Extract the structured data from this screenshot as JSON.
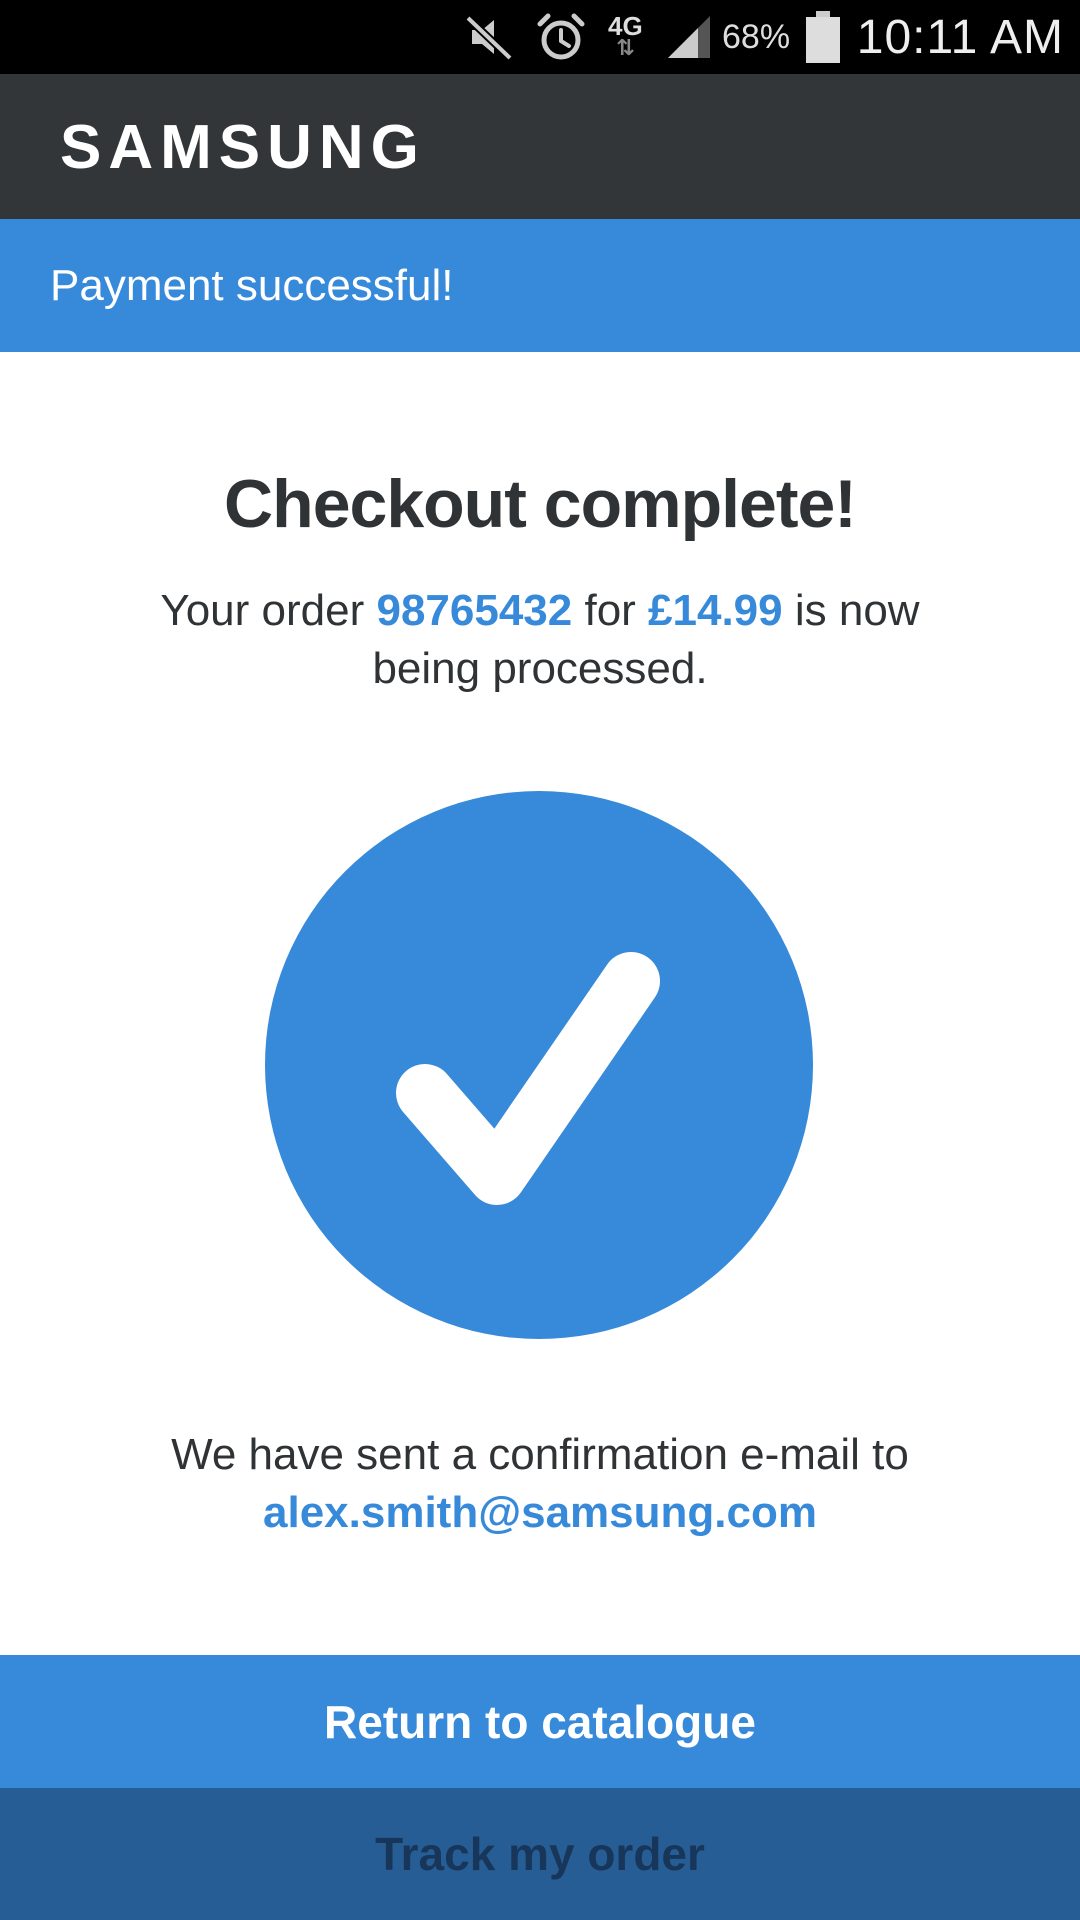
{
  "status_bar": {
    "network": "4G",
    "network_arrows": "⇅",
    "battery_percent": "68%",
    "time": "10:11 AM",
    "icons": [
      "mute-icon",
      "alarm-icon",
      "network-4g-icon",
      "signal-icon",
      "battery-icon"
    ]
  },
  "header": {
    "brand": "SAMSUNG"
  },
  "banner": {
    "message": "Payment successful!"
  },
  "main": {
    "title": "Checkout complete!",
    "order_prefix": "Your order ",
    "order_number": "98765432",
    "order_middle": " for ",
    "order_amount": "£14.99",
    "order_suffix": " is now being processed.",
    "confirmation_text": "We have sent a confirmation e-mail to",
    "email": "alex.smith@samsung.com",
    "success_icon": "checkmark-circle-icon"
  },
  "buttons": {
    "primary_label": "Return to catalogue",
    "secondary_label": "Track my order"
  },
  "colors": {
    "accent": "#3789d9",
    "header_bg": "#333639",
    "secondary_button_bg": "#275d95",
    "secondary_button_text": "#17365a",
    "text_dark": "#303336"
  }
}
